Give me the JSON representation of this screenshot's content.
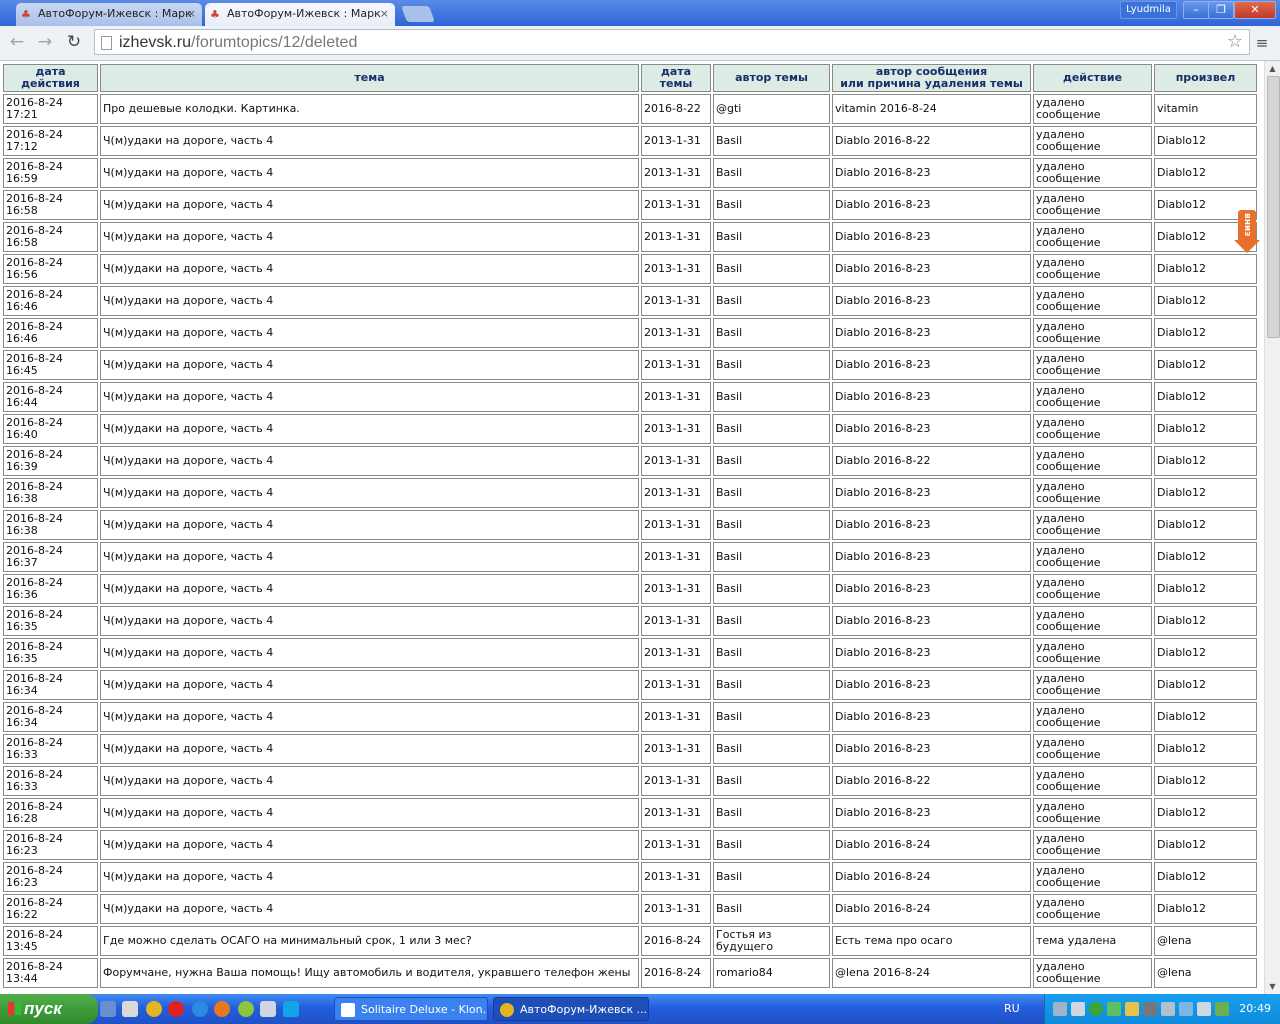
{
  "browser": {
    "tabs": [
      {
        "title": "АвтоФорум-Ижевск : Марк",
        "active": false
      },
      {
        "title": "АвтоФорум-Ижевск : Марк",
        "active": true
      }
    ],
    "user": "Lyudmila",
    "window_buttons": {
      "minimize": "–",
      "maximize": "❐",
      "close": "✕"
    },
    "url_domain": "izhevsk.ru",
    "url_path": "/forumtopics/12/deleted"
  },
  "table": {
    "headers": {
      "action_date": [
        "дата",
        "действия"
      ],
      "topic": "тема",
      "topic_date": [
        "дата",
        "темы"
      ],
      "topic_author": "автор темы",
      "message_author": [
        "автор сообщения",
        "или причина удаления темы"
      ],
      "action": "действие",
      "performed_by": "произвел"
    },
    "rows": [
      {
        "date": "2016-8-24",
        "time": "17:21",
        "topic": "Про дешевые колодки. Картинка.",
        "tdate": "2016-8-22",
        "tauthor": "@gti",
        "mauthor": "vitamin 2016-8-24",
        "a1": "удалено",
        "a2": "сообщение",
        "by": "vitamin"
      },
      {
        "date": "2016-8-24",
        "time": "17:12",
        "topic": "Ч(м)удаки на дороге, часть 4",
        "tdate": "2013-1-31",
        "tauthor": "Basil",
        "mauthor": "Diablo 2016-8-22",
        "a1": "удалено",
        "a2": "сообщение",
        "by": "Diablo12"
      },
      {
        "date": "2016-8-24",
        "time": "16:59",
        "topic": "Ч(м)удаки на дороге, часть 4",
        "tdate": "2013-1-31",
        "tauthor": "Basil",
        "mauthor": "Diablo 2016-8-23",
        "a1": "удалено",
        "a2": "сообщение",
        "by": "Diablo12"
      },
      {
        "date": "2016-8-24",
        "time": "16:58",
        "topic": "Ч(м)удаки на дороге, часть 4",
        "tdate": "2013-1-31",
        "tauthor": "Basil",
        "mauthor": "Diablo 2016-8-23",
        "a1": "удалено",
        "a2": "сообщение",
        "by": "Diablo12"
      },
      {
        "date": "2016-8-24",
        "time": "16:58",
        "topic": "Ч(м)удаки на дороге, часть 4",
        "tdate": "2013-1-31",
        "tauthor": "Basil",
        "mauthor": "Diablo 2016-8-23",
        "a1": "удалено",
        "a2": "сообщение",
        "by": "Diablo12"
      },
      {
        "date": "2016-8-24",
        "time": "16:56",
        "topic": "Ч(м)удаки на дороге, часть 4",
        "tdate": "2013-1-31",
        "tauthor": "Basil",
        "mauthor": "Diablo 2016-8-23",
        "a1": "удалено",
        "a2": "сообщение",
        "by": "Diablo12"
      },
      {
        "date": "2016-8-24",
        "time": "16:46",
        "topic": "Ч(м)удаки на дороге, часть 4",
        "tdate": "2013-1-31",
        "tauthor": "Basil",
        "mauthor": "Diablo 2016-8-23",
        "a1": "удалено",
        "a2": "сообщение",
        "by": "Diablo12"
      },
      {
        "date": "2016-8-24",
        "time": "16:46",
        "topic": "Ч(м)удаки на дороге, часть 4",
        "tdate": "2013-1-31",
        "tauthor": "Basil",
        "mauthor": "Diablo 2016-8-23",
        "a1": "удалено",
        "a2": "сообщение",
        "by": "Diablo12"
      },
      {
        "date": "2016-8-24",
        "time": "16:45",
        "topic": "Ч(м)удаки на дороге, часть 4",
        "tdate": "2013-1-31",
        "tauthor": "Basil",
        "mauthor": "Diablo 2016-8-23",
        "a1": "удалено",
        "a2": "сообщение",
        "by": "Diablo12"
      },
      {
        "date": "2016-8-24",
        "time": "16:44",
        "topic": "Ч(м)удаки на дороге, часть 4",
        "tdate": "2013-1-31",
        "tauthor": "Basil",
        "mauthor": "Diablo 2016-8-23",
        "a1": "удалено",
        "a2": "сообщение",
        "by": "Diablo12"
      },
      {
        "date": "2016-8-24",
        "time": "16:40",
        "topic": "Ч(м)удаки на дороге, часть 4",
        "tdate": "2013-1-31",
        "tauthor": "Basil",
        "mauthor": "Diablo 2016-8-23",
        "a1": "удалено",
        "a2": "сообщение",
        "by": "Diablo12"
      },
      {
        "date": "2016-8-24",
        "time": "16:39",
        "topic": "Ч(м)удаки на дороге, часть 4",
        "tdate": "2013-1-31",
        "tauthor": "Basil",
        "mauthor": "Diablo 2016-8-22",
        "a1": "удалено",
        "a2": "сообщение",
        "by": "Diablo12"
      },
      {
        "date": "2016-8-24",
        "time": "16:38",
        "topic": "Ч(м)удаки на дороге, часть 4",
        "tdate": "2013-1-31",
        "tauthor": "Basil",
        "mauthor": "Diablo 2016-8-23",
        "a1": "удалено",
        "a2": "сообщение",
        "by": "Diablo12"
      },
      {
        "date": "2016-8-24",
        "time": "16:38",
        "topic": "Ч(м)удаки на дороге, часть 4",
        "tdate": "2013-1-31",
        "tauthor": "Basil",
        "mauthor": "Diablo 2016-8-23",
        "a1": "удалено",
        "a2": "сообщение",
        "by": "Diablo12"
      },
      {
        "date": "2016-8-24",
        "time": "16:37",
        "topic": "Ч(м)удаки на дороге, часть 4",
        "tdate": "2013-1-31",
        "tauthor": "Basil",
        "mauthor": "Diablo 2016-8-23",
        "a1": "удалено",
        "a2": "сообщение",
        "by": "Diablo12"
      },
      {
        "date": "2016-8-24",
        "time": "16:36",
        "topic": "Ч(м)удаки на дороге, часть 4",
        "tdate": "2013-1-31",
        "tauthor": "Basil",
        "mauthor": "Diablo 2016-8-23",
        "a1": "удалено",
        "a2": "сообщение",
        "by": "Diablo12"
      },
      {
        "date": "2016-8-24",
        "time": "16:35",
        "topic": "Ч(м)удаки на дороге, часть 4",
        "tdate": "2013-1-31",
        "tauthor": "Basil",
        "mauthor": "Diablo 2016-8-23",
        "a1": "удалено",
        "a2": "сообщение",
        "by": "Diablo12"
      },
      {
        "date": "2016-8-24",
        "time": "16:35",
        "topic": "Ч(м)удаки на дороге, часть 4",
        "tdate": "2013-1-31",
        "tauthor": "Basil",
        "mauthor": "Diablo 2016-8-23",
        "a1": "удалено",
        "a2": "сообщение",
        "by": "Diablo12"
      },
      {
        "date": "2016-8-24",
        "time": "16:34",
        "topic": "Ч(м)удаки на дороге, часть 4",
        "tdate": "2013-1-31",
        "tauthor": "Basil",
        "mauthor": "Diablo 2016-8-23",
        "a1": "удалено",
        "a2": "сообщение",
        "by": "Diablo12"
      },
      {
        "date": "2016-8-24",
        "time": "16:34",
        "topic": "Ч(м)удаки на дороге, часть 4",
        "tdate": "2013-1-31",
        "tauthor": "Basil",
        "mauthor": "Diablo 2016-8-23",
        "a1": "удалено",
        "a2": "сообщение",
        "by": "Diablo12"
      },
      {
        "date": "2016-8-24",
        "time": "16:33",
        "topic": "Ч(м)удаки на дороге, часть 4",
        "tdate": "2013-1-31",
        "tauthor": "Basil",
        "mauthor": "Diablo 2016-8-23",
        "a1": "удалено",
        "a2": "сообщение",
        "by": "Diablo12"
      },
      {
        "date": "2016-8-24",
        "time": "16:33",
        "topic": "Ч(м)удаки на дороге, часть 4",
        "tdate": "2013-1-31",
        "tauthor": "Basil",
        "mauthor": "Diablo 2016-8-22",
        "a1": "удалено",
        "a2": "сообщение",
        "by": "Diablo12"
      },
      {
        "date": "2016-8-24",
        "time": "16:28",
        "topic": "Ч(м)удаки на дороге, часть 4",
        "tdate": "2013-1-31",
        "tauthor": "Basil",
        "mauthor": "Diablo 2016-8-23",
        "a1": "удалено",
        "a2": "сообщение",
        "by": "Diablo12"
      },
      {
        "date": "2016-8-24",
        "time": "16:23",
        "topic": "Ч(м)удаки на дороге, часть 4",
        "tdate": "2013-1-31",
        "tauthor": "Basil",
        "mauthor": "Diablo 2016-8-24",
        "a1": "удалено",
        "a2": "сообщение",
        "by": "Diablo12"
      },
      {
        "date": "2016-8-24",
        "time": "16:23",
        "topic": "Ч(м)удаки на дороге, часть 4",
        "tdate": "2013-1-31",
        "tauthor": "Basil",
        "mauthor": "Diablo 2016-8-24",
        "a1": "удалено",
        "a2": "сообщение",
        "by": "Diablo12"
      },
      {
        "date": "2016-8-24",
        "time": "16:22",
        "topic": "Ч(м)удаки на дороге, часть 4",
        "tdate": "2013-1-31",
        "tauthor": "Basil",
        "mauthor": "Diablo 2016-8-24",
        "a1": "удалено",
        "a2": "сообщение",
        "by": "Diablo12"
      },
      {
        "date": "2016-8-24",
        "time": "13:45",
        "topic": "Где можно сделать ОСАГО на минимальный срок, 1 или 3 мес?",
        "tdate": "2016-8-24",
        "tauthor": "Гостья из будущего",
        "mauthor": "Есть тема про осаго",
        "a1": "тема удалена",
        "a2": "",
        "by": "@lena"
      },
      {
        "date": "2016-8-24",
        "time": "13:44",
        "topic": "Форумчане, нужна Ваша помощь! Ищу автомобиль и водителя, укравшего телефон жены",
        "tdate": "2016-8-24",
        "tauthor": "romario84",
        "mauthor": "@lena 2016-8-24",
        "a1": "удалено",
        "a2": "сообщение",
        "by": "@lena"
      }
    ]
  },
  "scroll_badge": "вниз",
  "taskbar": {
    "start_label": "пуск",
    "tasks": [
      {
        "label": "Solitaire Deluxe - Klon...",
        "active": false
      },
      {
        "label": "АвтоФорум-Ижевск ...",
        "active": true
      }
    ],
    "language": "RU",
    "clock": "20:49"
  },
  "colors": {
    "header_bg": "#dcebe4",
    "header_text": "#1a2d6b",
    "taskbar": "#245edc",
    "start": "#2f8a2c"
  }
}
